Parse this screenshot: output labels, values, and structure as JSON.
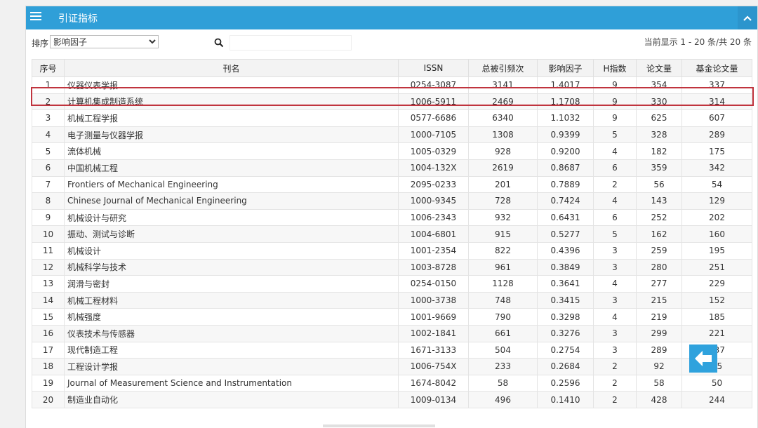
{
  "header": {
    "title": "引证指标"
  },
  "toolbar": {
    "sort_label": "排序",
    "sort_value": "影响因子",
    "search_placeholder": "",
    "page_info": "当前显示 1 - 20 条/共 20 条"
  },
  "table": {
    "columns": [
      "序号",
      "刊名",
      "ISSN",
      "总被引频次",
      "影响因子",
      "H指数",
      "论文量",
      "基金论文量"
    ],
    "rows": [
      [
        "1",
        "仪器仪表学报",
        "0254-3087",
        "3141",
        "1.4017",
        "9",
        "354",
        "337"
      ],
      [
        "2",
        "计算机集成制造系统",
        "1006-5911",
        "2469",
        "1.1708",
        "9",
        "330",
        "314"
      ],
      [
        "3",
        "机械工程学报",
        "0577-6686",
        "6340",
        "1.1032",
        "9",
        "625",
        "607"
      ],
      [
        "4",
        "电子测量与仪器学报",
        "1000-7105",
        "1308",
        "0.9399",
        "5",
        "328",
        "289"
      ],
      [
        "5",
        "流体机械",
        "1005-0329",
        "928",
        "0.9200",
        "4",
        "182",
        "175"
      ],
      [
        "6",
        "中国机械工程",
        "1004-132X",
        "2619",
        "0.8687",
        "6",
        "359",
        "342"
      ],
      [
        "7",
        "Frontiers of Mechanical Engineering",
        "2095-0233",
        "201",
        "0.7889",
        "2",
        "56",
        "54"
      ],
      [
        "8",
        "Chinese Journal of Mechanical Engineering",
        "1000-9345",
        "728",
        "0.7424",
        "4",
        "143",
        "129"
      ],
      [
        "9",
        "机械设计与研究",
        "1006-2343",
        "932",
        "0.6431",
        "6",
        "252",
        "202"
      ],
      [
        "10",
        "振动、测试与诊断",
        "1004-6801",
        "915",
        "0.5277",
        "5",
        "162",
        "160"
      ],
      [
        "11",
        "机械设计",
        "1001-2354",
        "822",
        "0.4396",
        "3",
        "259",
        "195"
      ],
      [
        "12",
        "机械科学与技术",
        "1003-8728",
        "961",
        "0.3849",
        "3",
        "280",
        "251"
      ],
      [
        "13",
        "润滑与密封",
        "0254-0150",
        "1128",
        "0.3641",
        "4",
        "277",
        "229"
      ],
      [
        "14",
        "机械工程材料",
        "1000-3738",
        "748",
        "0.3415",
        "3",
        "215",
        "152"
      ],
      [
        "15",
        "机械强度",
        "1001-9669",
        "790",
        "0.3298",
        "4",
        "219",
        "185"
      ],
      [
        "16",
        "仪表技术与传感器",
        "1002-1841",
        "661",
        "0.3276",
        "3",
        "299",
        "221"
      ],
      [
        "17",
        "现代制造工程",
        "1671-3133",
        "504",
        "0.2754",
        "3",
        "289",
        "237"
      ],
      [
        "18",
        "工程设计学报",
        "1006-754X",
        "233",
        "0.2684",
        "2",
        "92",
        "85"
      ],
      [
        "19",
        "Journal of Measurement Science and Instrumentation",
        "1674-8042",
        "58",
        "0.2596",
        "2",
        "58",
        "50"
      ],
      [
        "20",
        "制造业自动化",
        "1009-0134",
        "496",
        "0.1410",
        "2",
        "428",
        "244"
      ]
    ]
  },
  "colors": {
    "header_blue": "#2f9fd8",
    "highlight_red": "#c0343e"
  },
  "icons": [
    "menu-icon",
    "chevron-up-icon",
    "search-icon",
    "back-arrow-icon"
  ]
}
